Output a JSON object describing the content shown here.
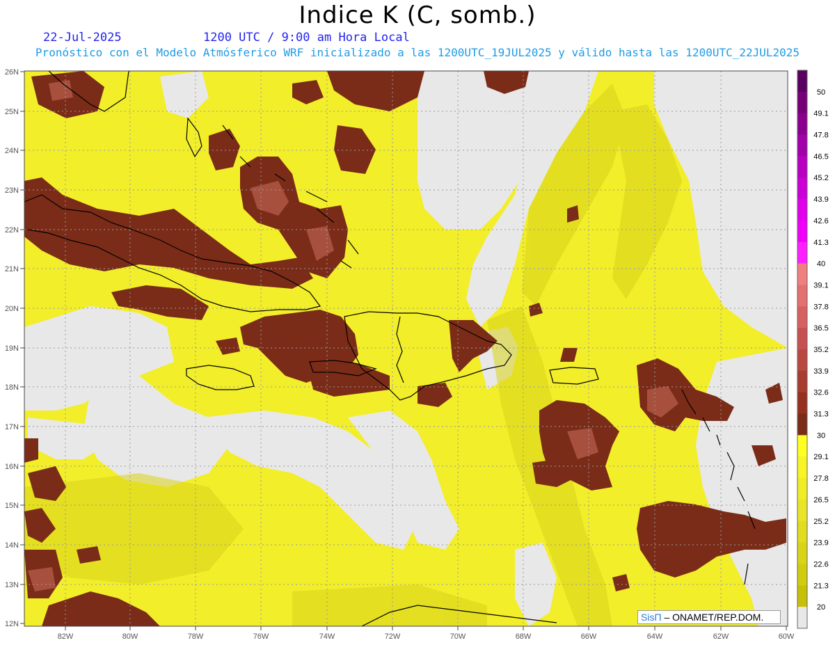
{
  "header": {
    "title": "Indice K (C, somb.)",
    "date": "22-Jul-2025",
    "time": "1200 UTC / 9:00 am Hora Local",
    "subtitle": "Pronóstico con el Modelo Atmósferico WRF inicializado a las 1200UTC_19JUL2025 y válido hasta las  1200UTC_22JUL2025"
  },
  "map": {
    "lat_labels": [
      "26N",
      "25N",
      "24N",
      "23N",
      "22N",
      "21N",
      "20N",
      "19N",
      "18N",
      "17N",
      "16N",
      "15N",
      "14N",
      "13N",
      "12N"
    ],
    "lon_labels": [
      "82W",
      "80W",
      "78W",
      "76W",
      "74W",
      "72W",
      "70W",
      "68W",
      "66W",
      "64W",
      "62W",
      "60W"
    ],
    "lat_range": [
      12,
      26
    ],
    "lon_range": [
      -83,
      -60
    ]
  },
  "colorbar": {
    "labels": [
      "50",
      "49.1",
      "47.8",
      "46.5",
      "45.2",
      "43.9",
      "42.6",
      "41.3",
      "40",
      "39.1",
      "37.8",
      "36.5",
      "35.2",
      "33.9",
      "32.6",
      "31.3",
      "30",
      "29.1",
      "27.8",
      "26.5",
      "25.2",
      "23.9",
      "22.6",
      "21.3",
      "20"
    ],
    "colors": [
      "#5a0060",
      "#760078",
      "#8c0090",
      "#a200a8",
      "#b800c0",
      "#cc00d6",
      "#e000ea",
      "#f000f8",
      "#ff20ff",
      "#f08080",
      "#e47070",
      "#d86060",
      "#c85050",
      "#b84840",
      "#a83c30",
      "#983020",
      "#7a2c18",
      "#ffff20",
      "#f8f428",
      "#f0ec28",
      "#e8e428",
      "#e0dc20",
      "#d8d418",
      "#d0cc10",
      "#c8c008",
      "#e8e8e8"
    ]
  },
  "credit": {
    "brand": "SisΠ",
    "text": " – ONAMET/REP.DOM."
  }
}
